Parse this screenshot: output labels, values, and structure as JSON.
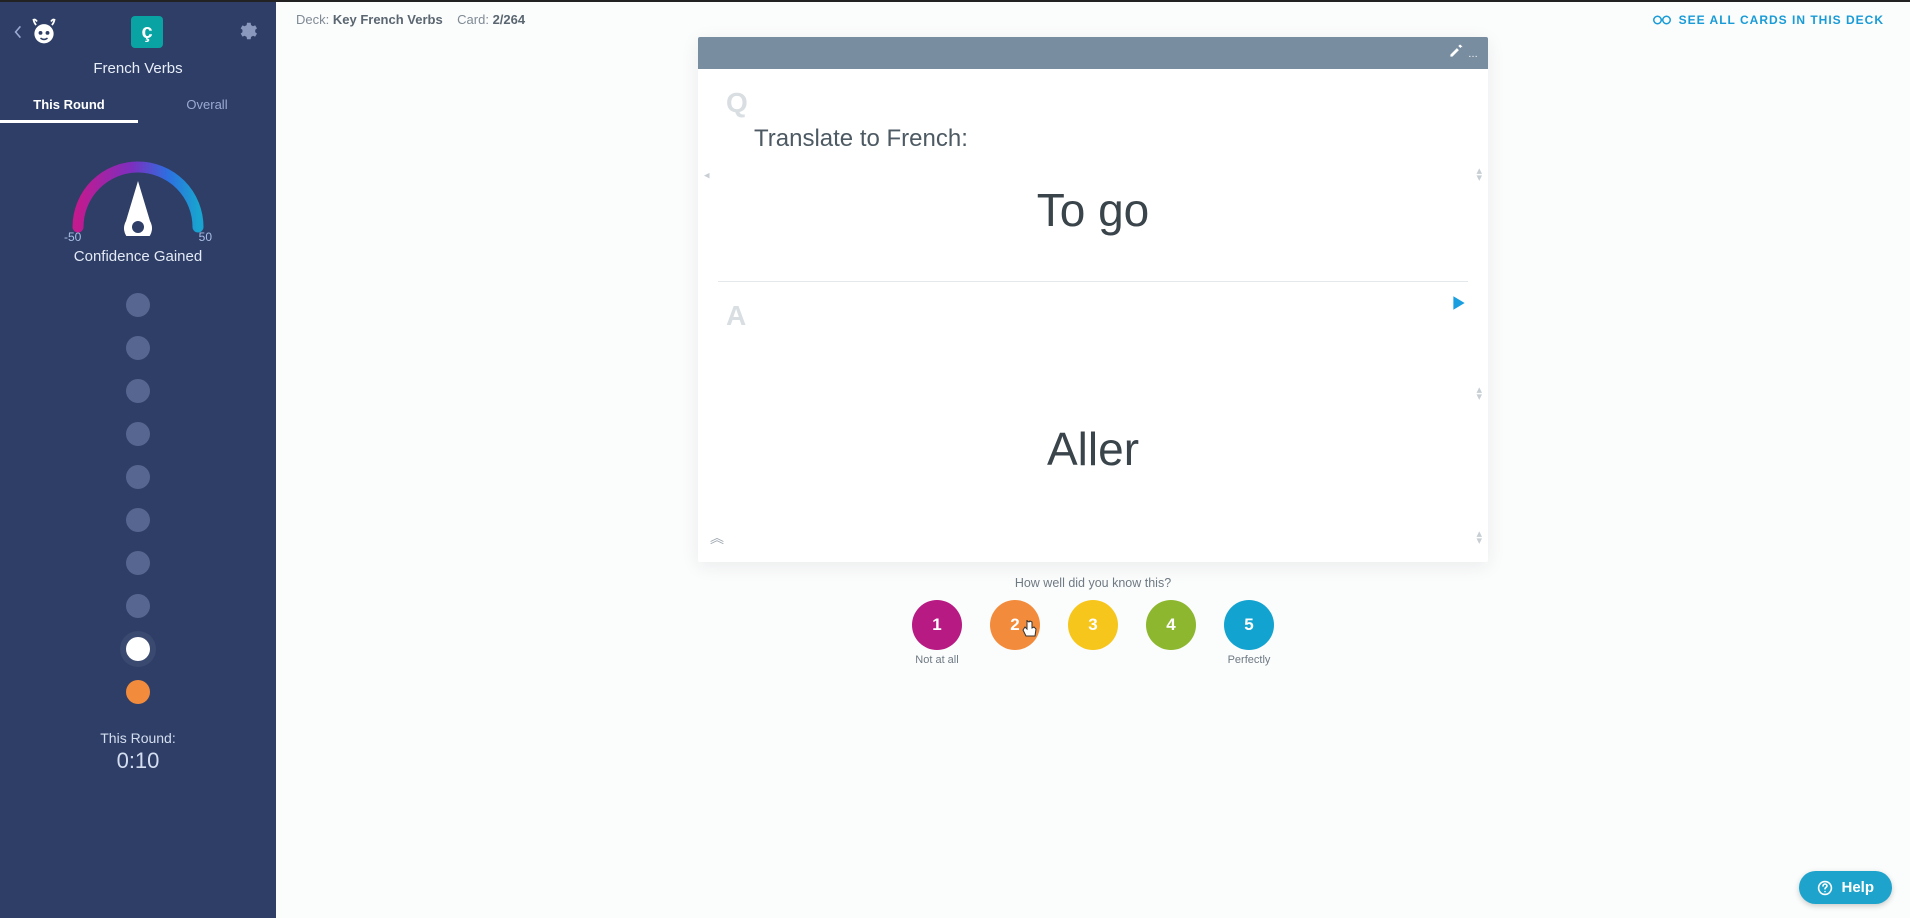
{
  "sidebar": {
    "logo_letter": "ç",
    "deck_title": "French Verbs",
    "tabs": {
      "this_round": "This Round",
      "overall": "Overall"
    },
    "gauge": {
      "min_label": "-50",
      "max_label": "50"
    },
    "confidence_label": "Confidence Gained",
    "dots": [
      "",
      "",
      "",
      "",
      "",
      "",
      "",
      "",
      "current",
      "rated-2"
    ],
    "round_label": "This Round:",
    "round_time": "0:10"
  },
  "topbar": {
    "deck_prefix": "Deck:",
    "deck_name": "Key French Verbs",
    "card_prefix": "Card:",
    "card_count": "2/264",
    "see_all": "See All Cards In This Deck"
  },
  "card": {
    "q_letter": "Q",
    "prompt": "Translate to French:",
    "question_word": "To go",
    "a_letter": "A",
    "answer_word": "Aller"
  },
  "rating": {
    "question": "How well did you know this?",
    "buttons": [
      "1",
      "2",
      "3",
      "4",
      "5"
    ],
    "caption_low": "Not at all",
    "caption_high": "Perfectly"
  },
  "help": {
    "label": "Help"
  }
}
